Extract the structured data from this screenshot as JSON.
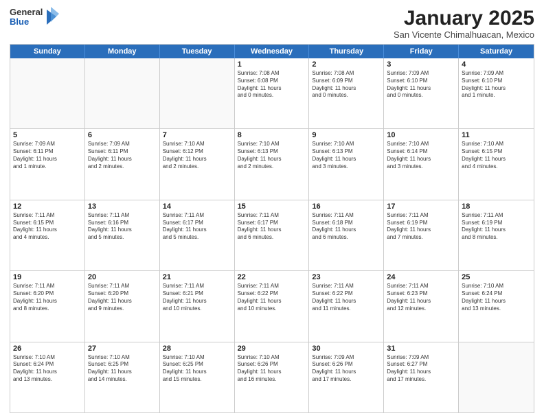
{
  "header": {
    "logo": {
      "general": "General",
      "blue": "Blue"
    },
    "title": "January 2025",
    "location": "San Vicente Chimalhuacan, Mexico"
  },
  "calendar": {
    "weekdays": [
      "Sunday",
      "Monday",
      "Tuesday",
      "Wednesday",
      "Thursday",
      "Friday",
      "Saturday"
    ],
    "rows": [
      [
        {
          "day": "",
          "empty": true,
          "lines": []
        },
        {
          "day": "",
          "empty": true,
          "lines": []
        },
        {
          "day": "",
          "empty": true,
          "lines": []
        },
        {
          "day": "1",
          "lines": [
            "Sunrise: 7:08 AM",
            "Sunset: 6:08 PM",
            "Daylight: 11 hours",
            "and 0 minutes."
          ]
        },
        {
          "day": "2",
          "lines": [
            "Sunrise: 7:08 AM",
            "Sunset: 6:09 PM",
            "Daylight: 11 hours",
            "and 0 minutes."
          ]
        },
        {
          "day": "3",
          "lines": [
            "Sunrise: 7:09 AM",
            "Sunset: 6:10 PM",
            "Daylight: 11 hours",
            "and 0 minutes."
          ]
        },
        {
          "day": "4",
          "lines": [
            "Sunrise: 7:09 AM",
            "Sunset: 6:10 PM",
            "Daylight: 11 hours",
            "and 1 minute."
          ]
        }
      ],
      [
        {
          "day": "5",
          "lines": [
            "Sunrise: 7:09 AM",
            "Sunset: 6:11 PM",
            "Daylight: 11 hours",
            "and 1 minute."
          ]
        },
        {
          "day": "6",
          "lines": [
            "Sunrise: 7:09 AM",
            "Sunset: 6:11 PM",
            "Daylight: 11 hours",
            "and 2 minutes."
          ]
        },
        {
          "day": "7",
          "lines": [
            "Sunrise: 7:10 AM",
            "Sunset: 6:12 PM",
            "Daylight: 11 hours",
            "and 2 minutes."
          ]
        },
        {
          "day": "8",
          "lines": [
            "Sunrise: 7:10 AM",
            "Sunset: 6:13 PM",
            "Daylight: 11 hours",
            "and 2 minutes."
          ]
        },
        {
          "day": "9",
          "lines": [
            "Sunrise: 7:10 AM",
            "Sunset: 6:13 PM",
            "Daylight: 11 hours",
            "and 3 minutes."
          ]
        },
        {
          "day": "10",
          "lines": [
            "Sunrise: 7:10 AM",
            "Sunset: 6:14 PM",
            "Daylight: 11 hours",
            "and 3 minutes."
          ]
        },
        {
          "day": "11",
          "lines": [
            "Sunrise: 7:10 AM",
            "Sunset: 6:15 PM",
            "Daylight: 11 hours",
            "and 4 minutes."
          ]
        }
      ],
      [
        {
          "day": "12",
          "lines": [
            "Sunrise: 7:11 AM",
            "Sunset: 6:15 PM",
            "Daylight: 11 hours",
            "and 4 minutes."
          ]
        },
        {
          "day": "13",
          "lines": [
            "Sunrise: 7:11 AM",
            "Sunset: 6:16 PM",
            "Daylight: 11 hours",
            "and 5 minutes."
          ]
        },
        {
          "day": "14",
          "lines": [
            "Sunrise: 7:11 AM",
            "Sunset: 6:17 PM",
            "Daylight: 11 hours",
            "and 5 minutes."
          ]
        },
        {
          "day": "15",
          "lines": [
            "Sunrise: 7:11 AM",
            "Sunset: 6:17 PM",
            "Daylight: 11 hours",
            "and 6 minutes."
          ]
        },
        {
          "day": "16",
          "lines": [
            "Sunrise: 7:11 AM",
            "Sunset: 6:18 PM",
            "Daylight: 11 hours",
            "and 6 minutes."
          ]
        },
        {
          "day": "17",
          "lines": [
            "Sunrise: 7:11 AM",
            "Sunset: 6:19 PM",
            "Daylight: 11 hours",
            "and 7 minutes."
          ]
        },
        {
          "day": "18",
          "lines": [
            "Sunrise: 7:11 AM",
            "Sunset: 6:19 PM",
            "Daylight: 11 hours",
            "and 8 minutes."
          ]
        }
      ],
      [
        {
          "day": "19",
          "lines": [
            "Sunrise: 7:11 AM",
            "Sunset: 6:20 PM",
            "Daylight: 11 hours",
            "and 8 minutes."
          ]
        },
        {
          "day": "20",
          "lines": [
            "Sunrise: 7:11 AM",
            "Sunset: 6:20 PM",
            "Daylight: 11 hours",
            "and 9 minutes."
          ]
        },
        {
          "day": "21",
          "lines": [
            "Sunrise: 7:11 AM",
            "Sunset: 6:21 PM",
            "Daylight: 11 hours",
            "and 10 minutes."
          ]
        },
        {
          "day": "22",
          "lines": [
            "Sunrise: 7:11 AM",
            "Sunset: 6:22 PM",
            "Daylight: 11 hours",
            "and 10 minutes."
          ]
        },
        {
          "day": "23",
          "lines": [
            "Sunrise: 7:11 AM",
            "Sunset: 6:22 PM",
            "Daylight: 11 hours",
            "and 11 minutes."
          ]
        },
        {
          "day": "24",
          "lines": [
            "Sunrise: 7:11 AM",
            "Sunset: 6:23 PM",
            "Daylight: 11 hours",
            "and 12 minutes."
          ]
        },
        {
          "day": "25",
          "lines": [
            "Sunrise: 7:10 AM",
            "Sunset: 6:24 PM",
            "Daylight: 11 hours",
            "and 13 minutes."
          ]
        }
      ],
      [
        {
          "day": "26",
          "lines": [
            "Sunrise: 7:10 AM",
            "Sunset: 6:24 PM",
            "Daylight: 11 hours",
            "and 13 minutes."
          ]
        },
        {
          "day": "27",
          "lines": [
            "Sunrise: 7:10 AM",
            "Sunset: 6:25 PM",
            "Daylight: 11 hours",
            "and 14 minutes."
          ]
        },
        {
          "day": "28",
          "lines": [
            "Sunrise: 7:10 AM",
            "Sunset: 6:25 PM",
            "Daylight: 11 hours",
            "and 15 minutes."
          ]
        },
        {
          "day": "29",
          "lines": [
            "Sunrise: 7:10 AM",
            "Sunset: 6:26 PM",
            "Daylight: 11 hours",
            "and 16 minutes."
          ]
        },
        {
          "day": "30",
          "lines": [
            "Sunrise: 7:09 AM",
            "Sunset: 6:26 PM",
            "Daylight: 11 hours",
            "and 17 minutes."
          ]
        },
        {
          "day": "31",
          "lines": [
            "Sunrise: 7:09 AM",
            "Sunset: 6:27 PM",
            "Daylight: 11 hours",
            "and 17 minutes."
          ]
        },
        {
          "day": "",
          "empty": true,
          "lines": []
        }
      ]
    ]
  }
}
